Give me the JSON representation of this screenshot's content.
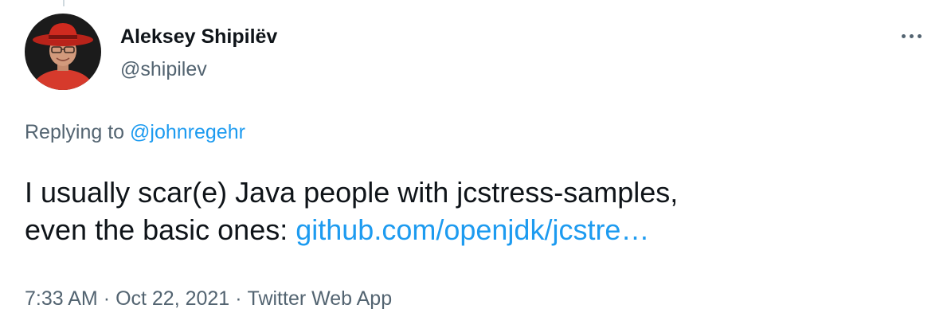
{
  "author": {
    "display_name": "Aleksey Shipilëv",
    "handle": "@shipilev"
  },
  "reply": {
    "prefix": "Replying to ",
    "to_handle": "@johnregehr"
  },
  "tweet": {
    "line1": "I usually scar(e) Java people with jcstress-samples,",
    "line2_text": "even the basic ones: ",
    "link": "github.com/openjdk/jcstre…"
  },
  "meta": {
    "time": "7:33 AM",
    "separator": "·",
    "date": "Oct 22, 2021",
    "source": "Twitter Web App"
  },
  "colors": {
    "link": "#1d9bf0",
    "secondary_text": "#536471",
    "primary_text": "#0f1419"
  },
  "icons": {
    "more": "more-options-icon",
    "avatar": "profile-photo"
  }
}
